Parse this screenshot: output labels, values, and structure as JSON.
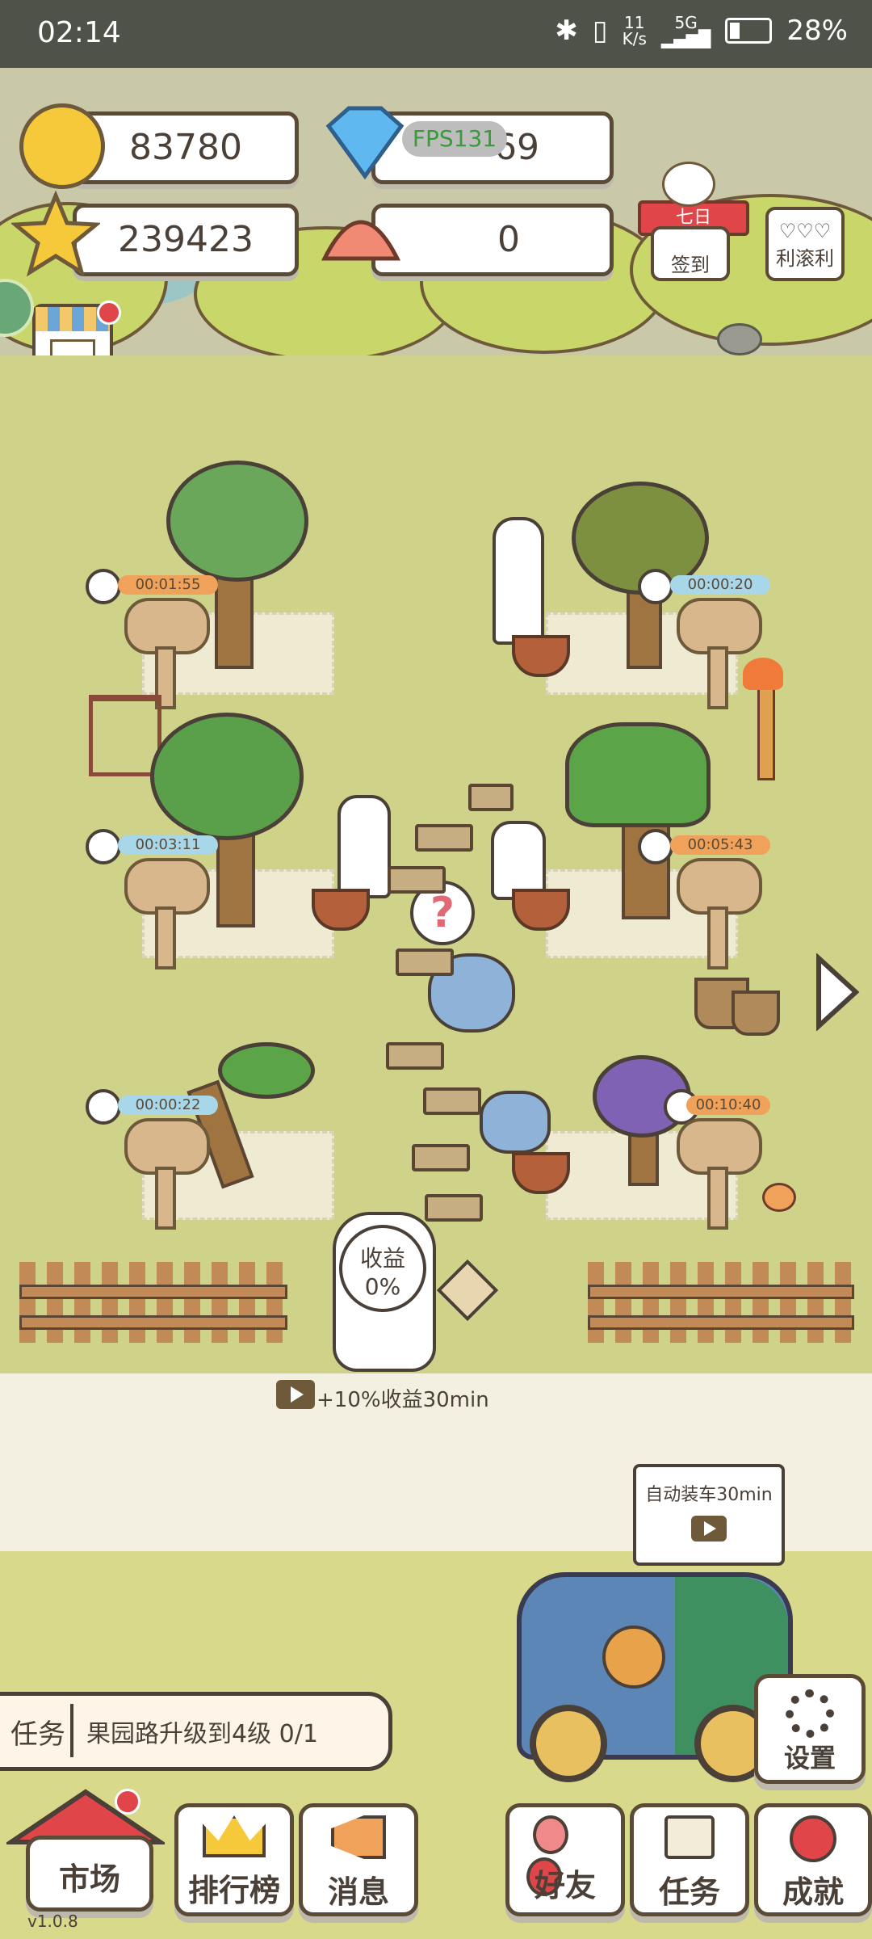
{
  "status_bar": {
    "time": "02:14",
    "net_speed_top": "11",
    "net_speed_bottom": "K/s",
    "signal": "5G",
    "battery": "28%"
  },
  "currencies": {
    "coins": "83780",
    "diamonds": "69",
    "stars": "239423",
    "shells": "0",
    "fps_overlay": "FPS131"
  },
  "top_buttons": {
    "seven_day": "七日",
    "checkin": "签到",
    "lucky": "利滚利",
    "shop": "商店"
  },
  "trees": [
    {
      "timer": "00:01:55"
    },
    {
      "timer": "00:00:20"
    },
    {
      "timer": "00:03:11"
    },
    {
      "timer": "00:05:43"
    },
    {
      "timer": "00:00:22"
    },
    {
      "timer": "00:10:40"
    }
  ],
  "income_badge": {
    "title": "收益",
    "value": "0%"
  },
  "ad_bonus": "+10%收益30min",
  "auto_load": "自动装车30min",
  "task_bar": {
    "label": "任务",
    "text": "果园路升级到4级 0/1"
  },
  "settings_label": "设置",
  "nav": {
    "market": "市场",
    "ranking": "排行榜",
    "messages": "消息",
    "friends": "好友",
    "tasks": "任务",
    "achievements": "成就"
  },
  "version": "v1.0.8",
  "colors": {
    "ground": "#cfd38a",
    "status_bar": "#4f5248",
    "timer_orange": "#f0a25a",
    "timer_blue": "#a9d7ea"
  }
}
